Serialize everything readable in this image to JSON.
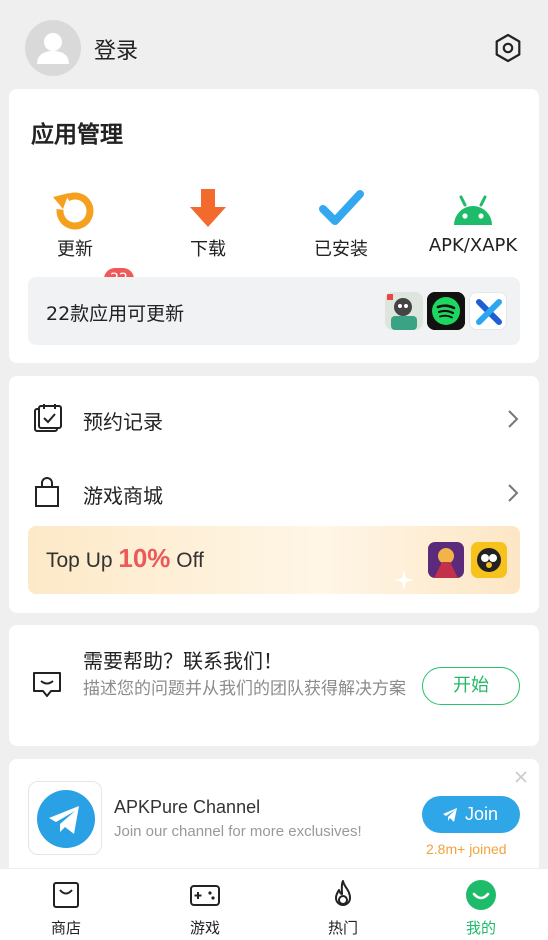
{
  "header": {
    "login_label": "登录"
  },
  "app_management": {
    "title": "应用管理",
    "tiles": [
      {
        "label": "更新",
        "icon": "refresh-icon"
      },
      {
        "label": "下载",
        "icon": "download-arrow-icon"
      },
      {
        "label": "已安装",
        "icon": "checkmark-icon"
      },
      {
        "label": "APK/XAPK",
        "icon": "android-icon"
      }
    ],
    "update_badge": "22",
    "update_summary": "22款应用可更新"
  },
  "menu": {
    "reservations": "预约记录",
    "game_store": "游戏商城",
    "topup": {
      "prefix": "Top Up ",
      "percent": "10%",
      "suffix": " Off"
    }
  },
  "help": {
    "title": "需要帮助？联系我们！",
    "description": "描述您的问题并从我们的团队获得解决方案",
    "button": "开始"
  },
  "telegram": {
    "name": "APKPure Channel",
    "subtitle": "Join our channel for more exclusives!",
    "button": "Join",
    "joined": "2.8m+ joined"
  },
  "bottom_nav": [
    {
      "label": "商店",
      "active": false
    },
    {
      "label": "游戏",
      "active": false
    },
    {
      "label": "热门",
      "active": false
    },
    {
      "label": "我的",
      "active": true
    }
  ],
  "colors": {
    "accent_green": "#1dbb6a",
    "badge_red": "#ee5a5a",
    "telegram_blue": "#2ea6e8",
    "orange": "#f08a2e"
  }
}
